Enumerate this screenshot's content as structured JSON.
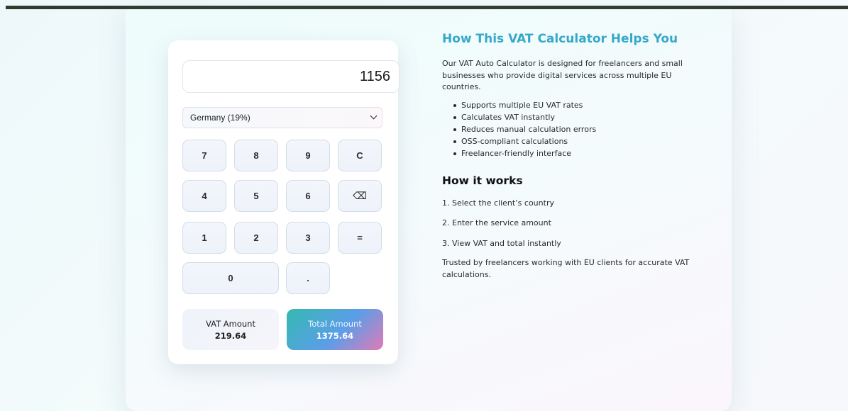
{
  "calculator": {
    "display_value": "1156",
    "country_selected": "Germany (19%)",
    "keys": {
      "k7": "7",
      "k8": "8",
      "k9": "9",
      "clear": "C",
      "k4": "4",
      "k5": "5",
      "k6": "6",
      "backspace": "⌫",
      "k1": "1",
      "k2": "2",
      "k3": "3",
      "equals": "=",
      "k0": "0",
      "dot": "."
    },
    "vat": {
      "label": "VAT Amount",
      "value": "219.64"
    },
    "total": {
      "label": "Total Amount",
      "value": "1375.64"
    }
  },
  "info": {
    "heading": "How This VAT Calculator Helps You",
    "intro": "Our VAT Auto Calculator is designed for freelancers and small businesses who provide digital services across multiple EU countries.",
    "features": [
      "Supports multiple EU VAT rates",
      "Calculates VAT instantly",
      "Reduces manual calculation errors",
      "OSS-compliant calculations",
      "Freelancer-friendly interface"
    ],
    "how_heading": "How it works",
    "steps": [
      "1. Select the client’s country",
      "2. Enter the service amount",
      "3. View VAT and total instantly"
    ],
    "trust": "Trusted by freelancers working with EU clients for accurate VAT calculations."
  }
}
